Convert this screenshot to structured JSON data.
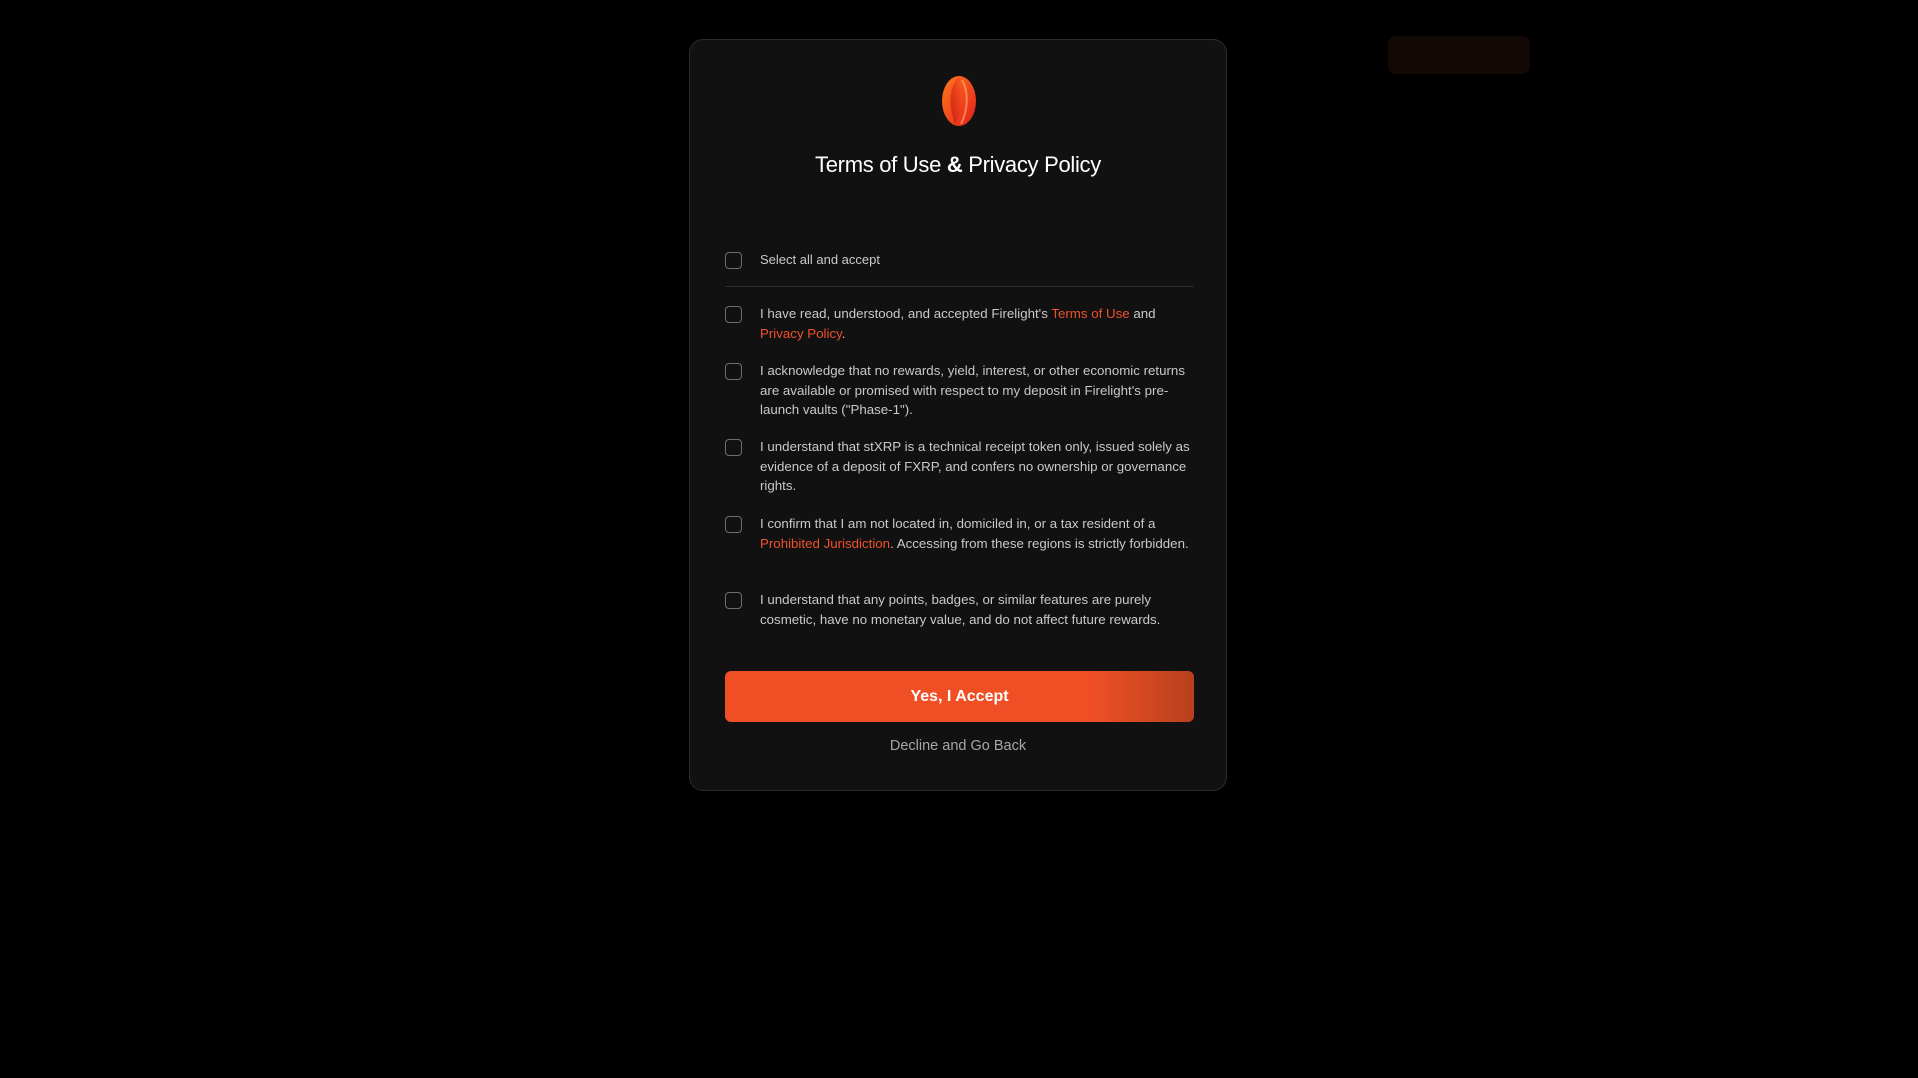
{
  "colors": {
    "accent": "#f04f26",
    "link": "#f0512a",
    "modal_bg": "#111111",
    "page_bg": "#000000"
  },
  "modal": {
    "logo_icon": "firelight-flame-icon",
    "title_part1": "Terms of Use ",
    "title_amp": "&",
    "title_part2": " Privacy Policy",
    "select_all_label": "Select all and accept",
    "items": [
      {
        "prefix": "I have read, understood, and accepted Firelight's ",
        "link1": "Terms of Use",
        "middle": " and ",
        "link2": "Privacy Policy",
        "suffix": "."
      },
      {
        "text": "I acknowledge that no rewards, yield, interest, or other economic returns are available or promised with respect to my deposit in Firelight's pre-launch vaults (\"Phase-1\")."
      },
      {
        "text": "I understand that stXRP is a technical receipt token only, issued solely as evidence of a deposit of FXRP, and confers no ownership or governance rights."
      },
      {
        "prefix": "I confirm that I am not located in, domiciled in, or a tax resident of a ",
        "link1": "Prohibited Jurisdiction",
        "suffix": ". Accessing from these regions is strictly forbidden."
      },
      {
        "text": "I understand that any points, badges, or similar features are purely cosmetic, have no monetary value, and do not affect future rewards."
      }
    ],
    "accept_label": "Yes, I Accept",
    "decline_label": "Decline and Go Back"
  }
}
